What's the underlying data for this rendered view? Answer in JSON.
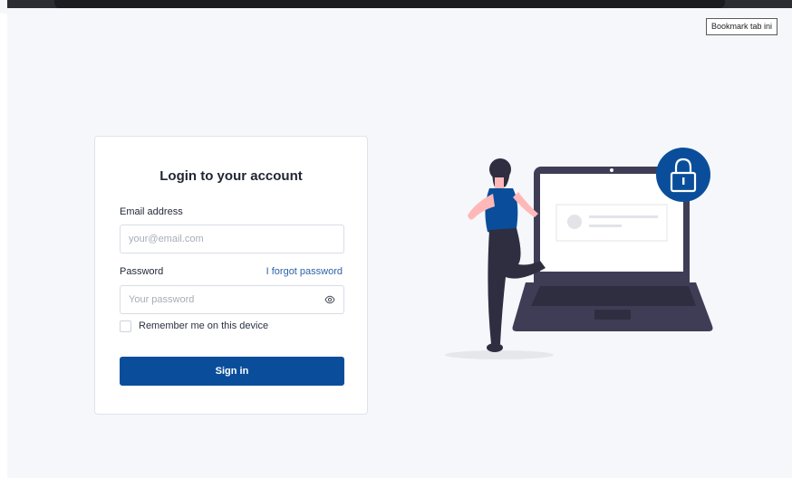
{
  "tooltip": {
    "text": "Bookmark tab ini"
  },
  "login": {
    "title": "Login to your account",
    "email_label": "Email address",
    "email_placeholder": "your@email.com",
    "password_label": "Password",
    "forgot_link": "I forgot password",
    "password_placeholder": "Your password",
    "remember_label": "Remember me on this device",
    "signin_label": "Sign in"
  },
  "icons": {
    "password_toggle": "eye-icon",
    "illustration_badge": "lock-icon"
  },
  "colors": {
    "primary": "#0a4e9b",
    "link": "#2d63a8",
    "background": "#f5f7fb",
    "illustration_accent": "#0a4e9b",
    "illustration_dark": "#3f3d56",
    "illustration_skin": "#ffb8b8"
  }
}
